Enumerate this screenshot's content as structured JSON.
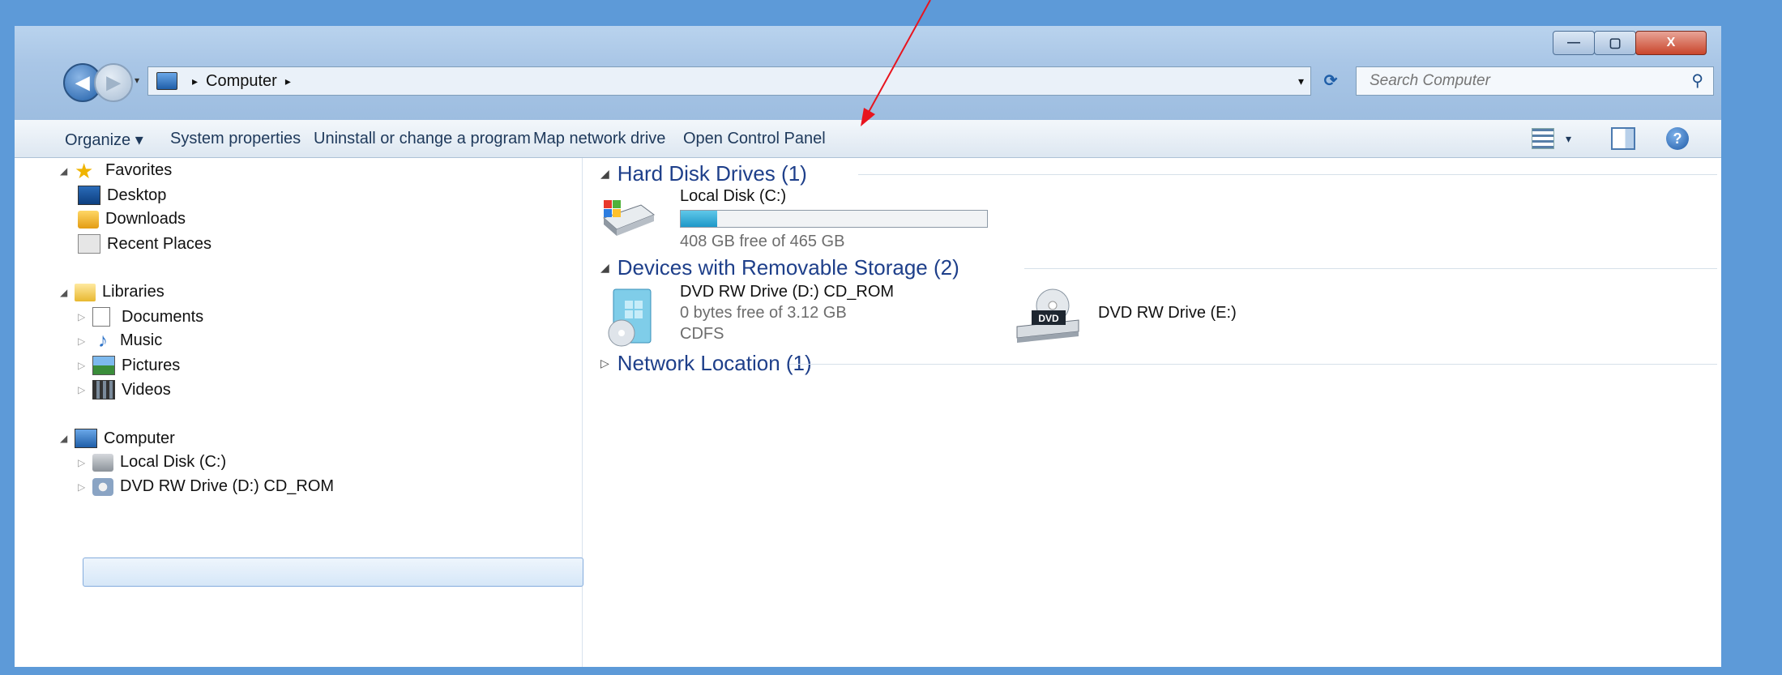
{
  "window": {
    "min_symbol": "—",
    "max_symbol": "▢",
    "close_symbol": "X"
  },
  "address": {
    "location": "Computer",
    "separator": "▸",
    "dropdown": "▾",
    "refresh": "⟳"
  },
  "search": {
    "placeholder": "Search Computer",
    "icon": "⚲"
  },
  "toolbar": {
    "organize": "Organize ▾",
    "system_properties": "System properties",
    "uninstall": "Uninstall or change a program",
    "map_network_drive": "Map network drive",
    "open_control_panel": "Open Control Panel",
    "view_dropdown": "▾",
    "help": "?"
  },
  "nav": {
    "favorites": "Favorites",
    "desktop": "Desktop",
    "downloads": "Downloads",
    "recent_places": "Recent Places",
    "libraries": "Libraries",
    "documents": "Documents",
    "music": "Music",
    "pictures": "Pictures",
    "videos": "Videos",
    "computer": "Computer",
    "local_disk": "Local Disk (C:)",
    "dvd_d": "DVD RW Drive (D:) CD_ROM",
    "expanded_glyph": "◢",
    "collapsed_glyph": "▷"
  },
  "content": {
    "hard_disk_group": "Hard Disk Drives (1)",
    "removable_group": "Devices with Removable Storage (2)",
    "network_group": "Network Location (1)",
    "local_disk": {
      "name": "Local Disk (C:)",
      "free": "408 GB free of 465 GB",
      "used_fraction": 0.12
    },
    "dvd_d": {
      "name": "DVD RW Drive (D:) CD_ROM",
      "free": "0 bytes free of 3.12 GB",
      "fs": "CDFS"
    },
    "dvd_e": {
      "name": "DVD RW Drive (E:)",
      "badge": "DVD"
    }
  },
  "colors": {
    "accent": "#1e3f8a",
    "annotation_arrow": "#e8141e"
  }
}
